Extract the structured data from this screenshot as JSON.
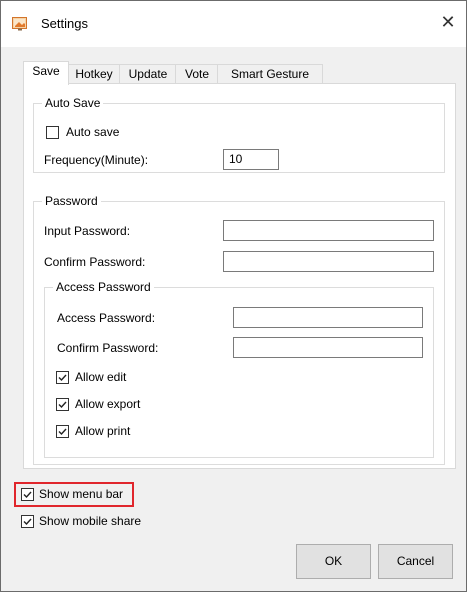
{
  "window": {
    "title": "Settings",
    "icon": "settings-app-icon",
    "close_glyph": "✕"
  },
  "tabs": [
    {
      "label": "Save",
      "active": true
    },
    {
      "label": "Hotkey",
      "active": false
    },
    {
      "label": "Update",
      "active": false
    },
    {
      "label": "Vote",
      "active": false
    },
    {
      "label": "Smart Gesture",
      "active": false
    }
  ],
  "auto_save": {
    "group_label": "Auto Save",
    "checkbox_label": "Auto save",
    "checked": false,
    "frequency_label": "Frequency(Minute):",
    "frequency_value": "10"
  },
  "password": {
    "group_label": "Password",
    "input_label": "Input Password:",
    "input_value": "",
    "confirm_label": "Confirm Password:",
    "confirm_value": "",
    "access": {
      "group_label": "Access Password",
      "access_label": "Access Password:",
      "access_value": "",
      "confirm_label": "Confirm Password:",
      "confirm_value": "",
      "allow_edit": {
        "label": "Allow edit",
        "checked": true
      },
      "allow_export": {
        "label": "Allow export",
        "checked": true
      },
      "allow_print": {
        "label": "Allow print",
        "checked": true
      }
    }
  },
  "bottom": {
    "show_menu_bar": {
      "label": "Show menu bar",
      "checked": true,
      "highlight_color": "#e0262c"
    },
    "show_mobile_share": {
      "label": "Show mobile share",
      "checked": true
    }
  },
  "buttons": {
    "ok": "OK",
    "cancel": "Cancel"
  }
}
